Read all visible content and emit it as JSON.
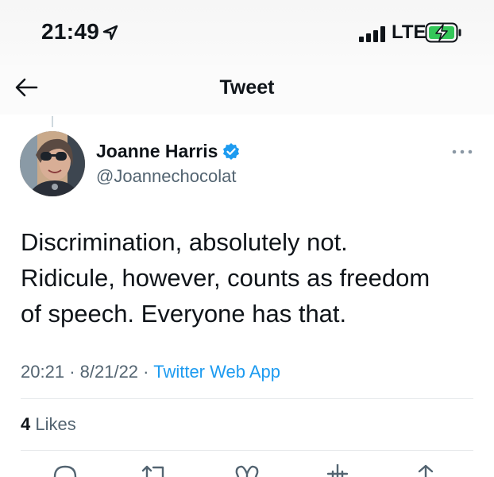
{
  "status_bar": {
    "time": "21:49",
    "network": "LTE",
    "location_icon": "location-arrow-icon",
    "signal_icon": "signal-bars-icon",
    "battery_icon": "battery-charging-icon",
    "battery_color": "#34c759"
  },
  "nav": {
    "title": "Tweet",
    "back_icon": "back-arrow-icon"
  },
  "tweet": {
    "author": {
      "display_name": "Joanne Harris",
      "handle": "@Joannechocolat",
      "verified": true
    },
    "text_lines": [
      "Discrimination, absolutely not.",
      "Ridicule, however, counts as freedom",
      "of speech. Everyone has that."
    ],
    "time": "20:21",
    "date": "8/21/22",
    "separator": "·",
    "source": "Twitter Web App"
  },
  "stats": {
    "likes_count": "4",
    "likes_label": "Likes"
  },
  "actions": [
    {
      "icon": "reply-icon"
    },
    {
      "icon": "retweet-icon"
    },
    {
      "icon": "like-icon"
    },
    {
      "icon": "share-icon"
    },
    {
      "icon": "upload-icon"
    }
  ],
  "colors": {
    "link": "#1d9bf0",
    "secondary_text": "#536471",
    "primary_text": "#0f1419",
    "divider": "#e6e9eb"
  }
}
